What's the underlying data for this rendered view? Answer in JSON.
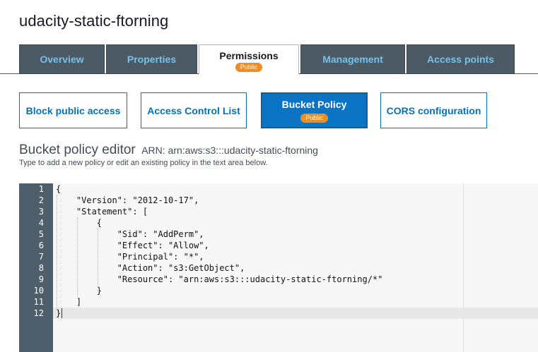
{
  "bucket": {
    "name": "udacity-static-ftorning"
  },
  "tabs": [
    {
      "label": "Overview"
    },
    {
      "label": "Properties"
    },
    {
      "label": "Permissions",
      "badge": "Public",
      "active": true
    },
    {
      "label": "Management"
    },
    {
      "label": "Access points"
    }
  ],
  "subtabs": [
    {
      "label": "Block public access"
    },
    {
      "label": "Access Control List"
    },
    {
      "label": "Bucket Policy",
      "badge": "Public",
      "active": true
    },
    {
      "label": "CORS configuration"
    }
  ],
  "editor": {
    "title": "Bucket policy editor",
    "arn": "ARN: arn:aws:s3:::udacity-static-ftorning",
    "help": "Type to add a new policy or edit an existing policy in the text area below.",
    "line_numbers": [
      "1",
      "2",
      "3",
      "4",
      "5",
      "6",
      "7",
      "8",
      "9",
      "10",
      "11",
      "12"
    ],
    "lines": [
      "{",
      "    \"Version\": \"2012-10-17\",",
      "    \"Statement\": [",
      "        {",
      "            \"Sid\": \"AddPerm\",",
      "            \"Effect\": \"Allow\",",
      "            \"Principal\": \"*\",",
      "            \"Action\": \"s3:GetObject\",",
      "            \"Resource\": \"arn:aws:s3:::udacity-static-ftorning/*\"",
      "        }",
      "    ]",
      "}"
    ]
  },
  "colors": {
    "tab_bg": "#4c5a66",
    "tab_text": "#79c0e8",
    "badge": "#ec8e23",
    "link_blue": "#0073bb",
    "gutter": "#4f5e6b"
  }
}
